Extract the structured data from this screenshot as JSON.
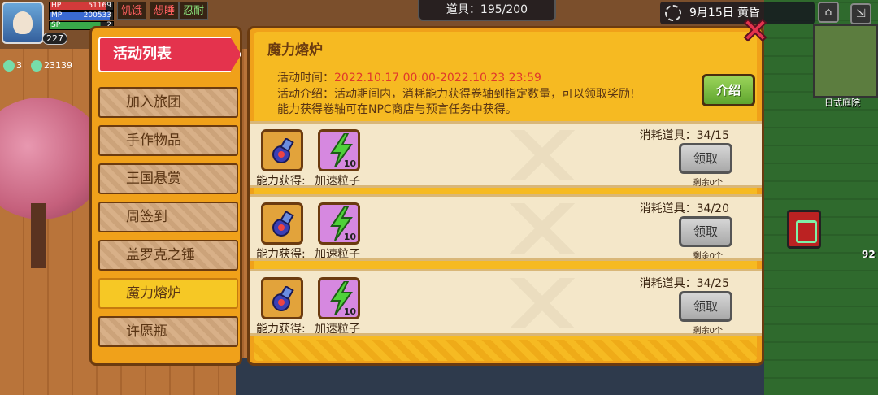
{
  "hud": {
    "hp_label": "HP",
    "hp_value": "51169",
    "mp_label": "MP",
    "mp_value": "200533",
    "sp_label": "SP",
    "sp_value": "2",
    "level": "227",
    "status_hungry": "饥饿",
    "status_sleepy": "想睡",
    "status_patience": "忍耐",
    "count_left": "3",
    "count_mid": "23139",
    "items_label": "道具：195/200",
    "date": "9月15日",
    "period": "黄昏",
    "minimap_label": "日式庭院",
    "side_number": "92"
  },
  "menu": {
    "header": "活动列表",
    "items": [
      {
        "label": "加入旅团"
      },
      {
        "label": "手作物品"
      },
      {
        "label": "王国悬赏"
      },
      {
        "label": "周签到"
      },
      {
        "label": "盖罗克之锤"
      },
      {
        "label": "魔力熔炉",
        "active": true
      },
      {
        "label": "许愿瓶"
      }
    ]
  },
  "panel": {
    "title": "魔力熔炉",
    "time_label": "活动时间：",
    "time_value": "2022.10.17 00:00-2022.10.23 23:59",
    "intro_line": "活动介绍：活动期间内，消耗能力获得卷轴到指定数量，可以领取奖励!",
    "source_line": "能力获得卷轴可在NPC商店与预言任务中获得。",
    "intro_button": "介绍",
    "rows": [
      {
        "item1": "能力获得:",
        "item2": "加速粒子",
        "qty": "10",
        "consume": "消耗道具：34/15",
        "claim": "领取",
        "remain": "剩余0个"
      },
      {
        "item1": "能力获得:",
        "item2": "加速粒子",
        "qty": "10",
        "consume": "消耗道具：34/20",
        "claim": "领取",
        "remain": "剩余0个"
      },
      {
        "item1": "能力获得:",
        "item2": "加速粒子",
        "qty": "10",
        "consume": "消耗道具：34/25",
        "claim": "领取",
        "remain": "剩余0个"
      }
    ]
  },
  "colors": {
    "accent_red": "#e4334d",
    "panel_orange": "#f0a11a",
    "time_red": "#e0392b",
    "intro_green": "#5fa52e"
  }
}
